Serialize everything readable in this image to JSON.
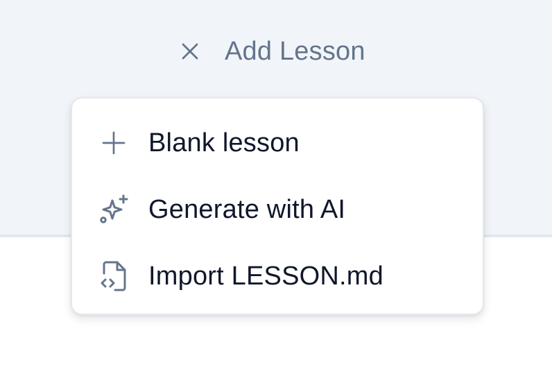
{
  "header": {
    "toggle_label": "Add Lesson",
    "toggle_icon": "close-icon"
  },
  "menu": {
    "items": [
      {
        "label": "Blank lesson",
        "icon": "plus-icon"
      },
      {
        "label": "Generate with AI",
        "icon": "sparkles-icon"
      },
      {
        "label": "Import LESSON.md",
        "icon": "file-code-icon"
      }
    ]
  },
  "colors": {
    "background_top": "#f1f5f9",
    "muted_text": "#64748b",
    "menu_text": "#0f172a",
    "menu_border": "#e5e7eb"
  }
}
